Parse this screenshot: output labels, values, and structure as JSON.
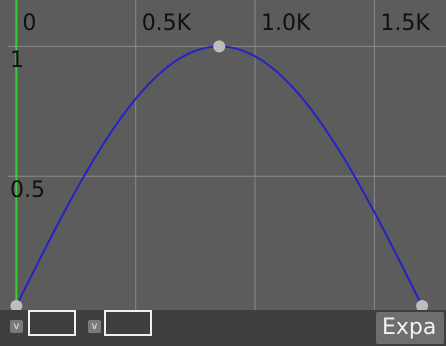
{
  "chart_data": {
    "type": "line",
    "x_tick_labels": [
      "0",
      "0.5K",
      "1.0K",
      "1.5K"
    ],
    "x_tick_values": [
      0,
      500,
      1000,
      1500
    ],
    "y_tick_labels": [
      "1",
      "0.5"
    ],
    "y_tick_values": [
      1,
      0.5
    ],
    "xlim": [
      -35,
      1800
    ],
    "ylim": [
      0,
      1.04
    ],
    "series": [
      {
        "color": "#2323c8",
        "points": [
          [
            0,
            0
          ],
          [
            850,
            1
          ],
          [
            1700,
            0
          ]
        ],
        "shape": "sine-arch"
      }
    ],
    "keyframes": [
      [
        0,
        0
      ],
      [
        850,
        1
      ],
      [
        1700,
        0
      ]
    ],
    "grid": true,
    "playhead": {
      "x": 0,
      "color": "#35d135"
    },
    "grid_color": "#8a8a8a",
    "background": "#5c5c5c"
  },
  "controls": {
    "key_toggle_1": "v",
    "key_toggle_2": "v",
    "expand_label": "Expa"
  }
}
